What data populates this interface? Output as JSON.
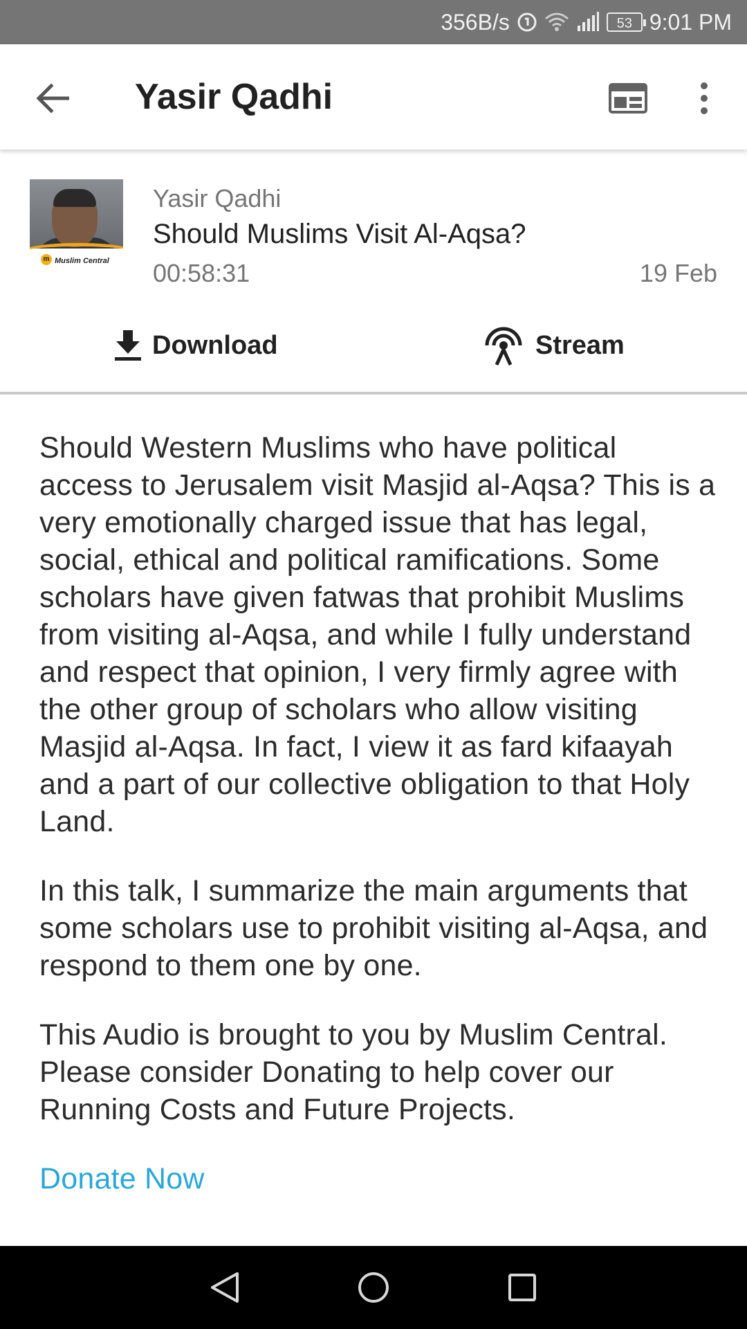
{
  "status_bar": {
    "network_speed": "356B/s",
    "battery_level": "53",
    "time": "9:01 PM",
    "icons": [
      "data-saver-icon",
      "wifi-icon",
      "signal-icon",
      "battery-icon"
    ]
  },
  "app_bar": {
    "title": "Yasir Qadhi",
    "icons": [
      "back-arrow-icon",
      "layout-icon",
      "more-vert-icon"
    ]
  },
  "episode": {
    "author": "Yasir Qadhi",
    "title": "Should Muslims Visit Al-Aqsa?",
    "duration": "00:58:31",
    "date": "19 Feb",
    "thumbnail_logo_text": "Muslim Central",
    "download_label": "Download",
    "stream_label": "Stream"
  },
  "description": {
    "paragraphs": [
      "Should Western Muslims who have political access to Jerusalem visit Masjid al-Aqsa? This is a very emotionally charged issue that has legal, social, ethical and political ramifications. Some scholars have given fatwas that prohibit Muslims from visiting al-Aqsa, and while I fully understand and respect that opinion, I very firmly agree with the other group of scholars who allow visiting Masjid al-Aqsa. In fact, I view it as fard kifaayah and a part of our collective obligation to that Holy Land.",
      "In this talk, I summarize the main arguments that some scholars use to prohibit visiting al-Aqsa, and respond to them one by one.",
      "This Audio is brought to you by Muslim Central. Please consider Donating to help cover our Running Costs and Future Projects."
    ],
    "donate_link": "Donate Now"
  },
  "colors": {
    "status_bar_bg": "#757575",
    "link": "#2aa7d8",
    "nav_bar_bg": "#000000"
  }
}
